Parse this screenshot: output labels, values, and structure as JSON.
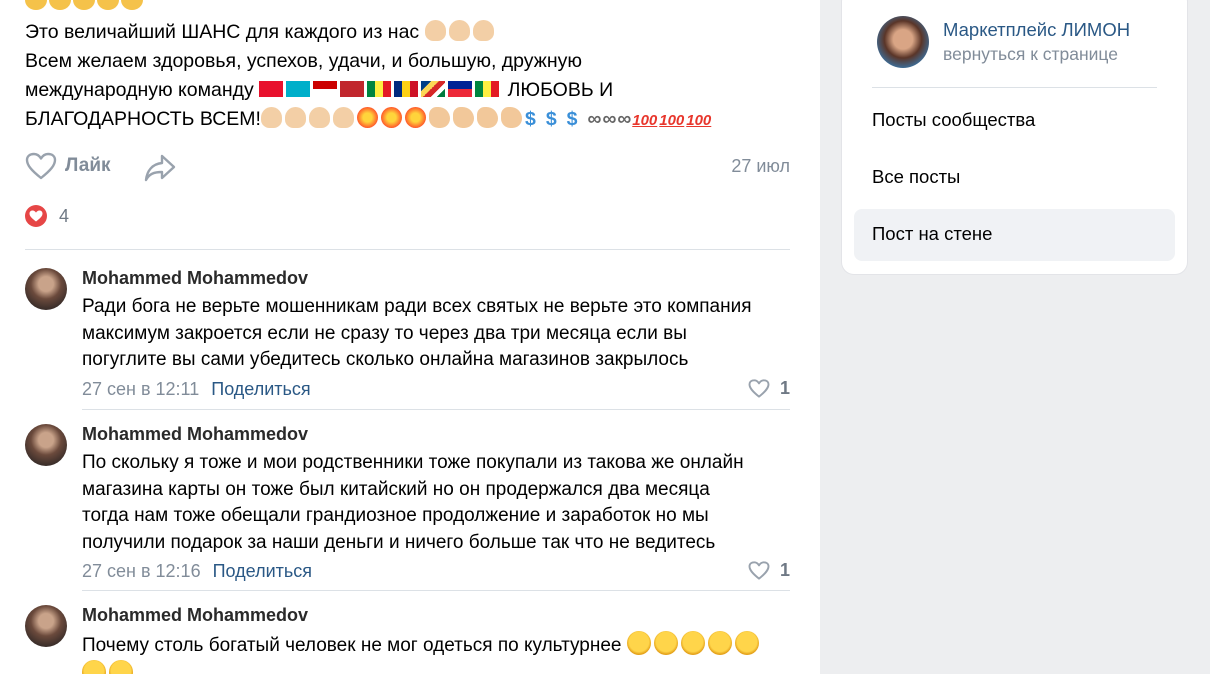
{
  "post": {
    "line1": "Это величайший ШАНС для каждого из нас",
    "line2": "Всем желаем здоровья, успехов, удачи, и большую, дружную",
    "line3": "международную команду",
    "line3_end": "ЛЮБОВЬ И",
    "line4": "БЛАГОДАРНОСТЬ ВСЕМ!",
    "like_label": "Лайк",
    "date": "27 июл",
    "likes_count": "4"
  },
  "comments": [
    {
      "author": "Mohammed Mohammedov",
      "lines": [
        "Ради бога не верьте мошенникам ради всех святых не верьте это компания",
        "максимум закроется если не сразу то через два три месяца если вы",
        "погуглите вы сами убедитесь сколько онлайна магазинов закрылось"
      ],
      "time": "27 сен в 12:11",
      "share_label": "Поделиться",
      "likes": "1"
    },
    {
      "author": "Mohammed Mohammedov",
      "lines": [
        "По скольку я тоже и мои родственники тоже покупали из такова же онлайн",
        "магазина карты он тоже был китайский но он продержался два месяца",
        "тогда нам тоже обещали грандиозное продолжение и заработок но мы",
        "получили подарок за наши деньги и ничего больше так что не ведитесь"
      ],
      "time": "27 сен в 12:16",
      "share_label": "Поделиться",
      "likes": "1"
    },
    {
      "author": "Mohammed Mohammedov",
      "lines": [
        "Почему столь богатый человек не мог одеться по культурнее"
      ]
    }
  ],
  "sidebar": {
    "community_name": "Маркетплейс ЛИМОН",
    "back_label": "вернуться к странице",
    "items": [
      {
        "label": "Посты сообщества"
      },
      {
        "label": "Все посты"
      },
      {
        "label": "Пост на стене"
      }
    ]
  },
  "colors": {
    "link": "#2a5885",
    "muted": "#818c99",
    "like_heart": "#e64646",
    "active_item_bg": "#f0f2f5"
  }
}
